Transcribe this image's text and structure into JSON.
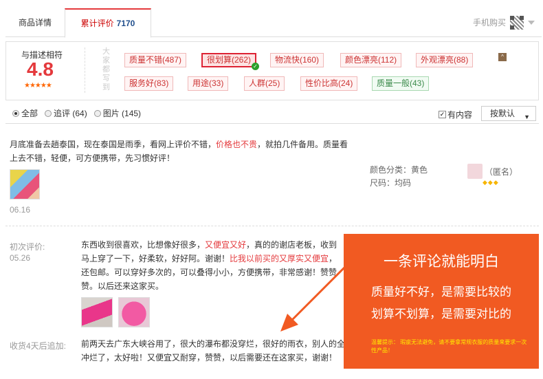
{
  "tabs": {
    "detail": "商品详情",
    "review_label": "累计评价",
    "review_count": "7170",
    "mobile_buy": "手机购买"
  },
  "rating": {
    "title": "与描述相符",
    "score": "4.8",
    "stars": "★★★★★",
    "stars_value": 5,
    "side_label": "大家都写到",
    "tags_row1": [
      "质量不错(487)",
      "很划算(262)",
      "物流快(160)",
      "颜色漂亮(112)",
      "外观漂亮(88)"
    ],
    "tags_row2": [
      "服务好(83)",
      "用途(33)",
      "人群(25)",
      "性价比高(24)",
      "质量一般(43)"
    ],
    "collapse": "^"
  },
  "filter": {
    "all": "全部",
    "followup": "追评 (64)",
    "pictures": "图片 (145)",
    "has_content": "有内容",
    "sort": "按默认"
  },
  "review1": {
    "text_a": "月底准备去趟泰国，现在泰国是雨季，看网上评价不错，",
    "text_hl": "价格也不贵",
    "text_b": "，就拍几件备用。质量看上去不错，轻便，可方便携带，先习惯好评！",
    "date": "06.16",
    "color": "颜色分类：黄色",
    "size": "尺码：均码",
    "user": "（匿名）",
    "diamonds": "◆◆◆"
  },
  "review2": {
    "first_label": "初次评价:",
    "first_date": "05.26",
    "t1": "东西收到很喜欢，比想像好很多，",
    "h1": "又便宜又好",
    "t2": "，真的的谢店老板，收到马上穿了一下，好柔软，好好阿。谢谢！",
    "h2": "比我以前买的又厚实又便宜",
    "t3": "，还包邮。可以穿好多次的，可以叠得小小，方便携带，非常感谢！赞赞赞。以后还来这家买。",
    "followup_label": "收货4天后追加:",
    "followup_text": "前两天去广东大峡谷用了，很大的瀑布都没穿烂，很好的雨衣，别人的全冲烂了，太好啦！又便宜又耐穿，赞赞，以后需要还在这家买，谢谢！"
  },
  "overlay": {
    "title": "一条评论就能明白",
    "line1": "质量好不好，是需要比较的",
    "line2": "划算不划算，是需要对比的",
    "note": "温馨提示：  瑕疵无法避免，请不要拿常规衣服的质量来要求一次性产品！"
  },
  "colors": {
    "accent": "#e4393c",
    "overlay": "#f15a22",
    "note": "#ffea00"
  }
}
